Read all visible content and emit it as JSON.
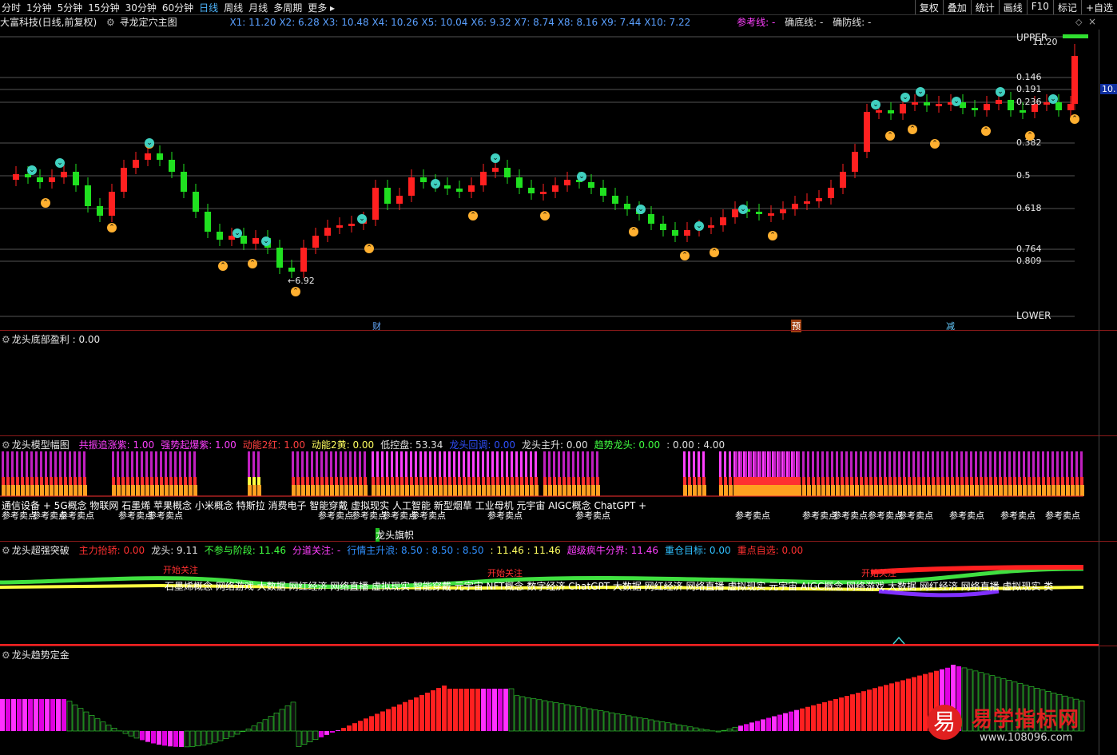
{
  "topbar": {
    "periods": [
      "分时",
      "1分钟",
      "5分钟",
      "15分钟",
      "30分钟",
      "60分钟",
      "日线",
      "周线",
      "月线",
      "多周期",
      "更多 ▸"
    ],
    "active": "日线",
    "right_buttons": [
      "复权",
      "叠加",
      "统计",
      "画线",
      "F10",
      "标记",
      "+自选"
    ]
  },
  "main": {
    "stock": "大富科技(日线,前复权)",
    "indicator": "寻龙定穴主图",
    "x_values": "X1: 11.20  X2: 6.28  X3: 10.48  X4: 10.26  X5: 10.04  X6: 9.32  X7: 8.74  X8: 8.16  X9: 7.44  X10: 7.22",
    "ref_line": "参考线: -",
    "bottom_line": "确底线: -",
    "defense_line": "确防线: -",
    "upper": "UPPER",
    "lower": "LOWER",
    "high": "11.20",
    "low": "6.92",
    "fib_levels": [
      "0.146",
      "0.191",
      "0.236",
      "0.382",
      "0.5",
      "0.618",
      "0.764",
      "0.809"
    ],
    "price_tag": "10.",
    "markers": [
      "财",
      "预",
      "减"
    ]
  },
  "panel2": {
    "title": "龙头底部盈利 : 0.00"
  },
  "panel3": {
    "title": "龙头模型幅图",
    "items": [
      {
        "t": "共振追涨紫: 1.00",
        "c": "#ff40ff"
      },
      {
        "t": "强势起爆紫: 1.00",
        "c": "#ff40ff"
      },
      {
        "t": "动能2红: 1.00",
        "c": "#ff4040"
      },
      {
        "t": "动能2黄: 0.00",
        "c": "#ffff60"
      },
      {
        "t": "低控盘: 53.34",
        "c": "#e0e0e0"
      },
      {
        "t": "龙头回调: 0.00",
        "c": "#3050ff"
      },
      {
        "t": "龙头主升: 0.00",
        "c": "#e0e0e0"
      },
      {
        "t": "趋势龙头: 0.00",
        "c": "#40ff40"
      },
      {
        "t": ": 0.00 : 4.00",
        "c": "#e0e0e0"
      }
    ],
    "concepts": "通信设备 + 5G概念 物联网 石墨烯 苹果概念 小米概念 特斯拉 消费电子 智能穿戴 虚拟现实 人工智能 新型烟草 工业母机 元宇宙 AIGC概念 ChatGPT +",
    "ref_sell": "参考卖点",
    "flag_text": "龙头旗帜"
  },
  "panel4": {
    "title": "龙头超强突破",
    "items": [
      {
        "t": "主力抬轿: 0.00",
        "c": "#ff3030"
      },
      {
        "t": "龙头: 9.11",
        "c": "#e0e0e0"
      },
      {
        "t": "不参与阶段: 11.46",
        "c": "#40ff40"
      },
      {
        "t": "分道关注: -",
        "c": "#ff40ff"
      },
      {
        "t": "行情主升浪: 8.50 : 8.50 : 8.50",
        "c": "#3090ff"
      },
      {
        "t": ": 11.46 : 11.46",
        "c": "#ffff60"
      },
      {
        "t": "超级疯牛分界: 11.46",
        "c": "#ff40ff"
      },
      {
        "t": "重仓目标: 0.00",
        "c": "#30c0ff"
      },
      {
        "t": "重点自选: 0.00",
        "c": "#ff3030"
      }
    ],
    "start_focus": "开始关注",
    "concepts2": "石墨烯概念 网络游戏 大数据 网红经济 网络直播 虚拟现实 智能穿戴 元宇宙 NFT概念 数字经济 ChatGPT 大数据 网红经济 网络直播 虚拟现实 元宇宙 AIGC概念 网络游戏 大数据 网红经济 网络直播 虚拟现实 类"
  },
  "panel5": {
    "title": "龙头趋势定金"
  },
  "watermark": {
    "brand": "易学指标网",
    "url": "www.108096.com",
    "glyph": "易"
  },
  "colors": {
    "up": "#ff2020",
    "down": "#20e020",
    "magenta": "#ff30ff",
    "yellow": "#ffff40",
    "orange": "#ffa020",
    "cyan": "#40e0d0"
  }
}
